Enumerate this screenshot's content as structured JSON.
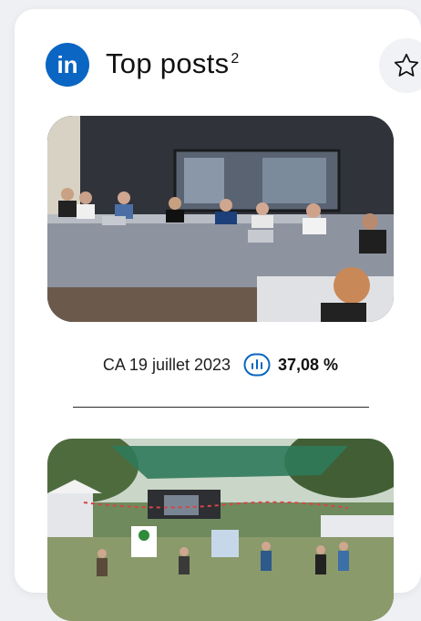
{
  "header": {
    "title": "Top posts",
    "title_sup": "2",
    "logo_text": "in",
    "logo_color": "#0a66c2"
  },
  "posts": [
    {
      "image_icon": "meeting-photo",
      "date_label": "CA 19 juillet 2023",
      "rate": "37,08 %",
      "stat_icon": "bar-chart-icon"
    },
    {
      "image_icon": "outdoor-event-photo"
    }
  ],
  "colors": {
    "accent": "#0a66c2",
    "star_bg": "#f0f2f5"
  }
}
